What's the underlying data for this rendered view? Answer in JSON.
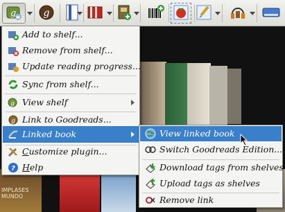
{
  "toolbar": {
    "buttons": [
      {
        "icon": "goodreads-sync-icon",
        "pressed": true
      },
      {
        "icon": "goodreads-g-icon"
      },
      {
        "icon": "bookmark-document-icon"
      },
      {
        "icon": "red-book-icon"
      },
      {
        "icon": "book-add-icon"
      },
      {
        "icon": "barcode-add-icon"
      },
      {
        "icon": "tomato-edit-icon"
      },
      {
        "icon": "paintbrush-edit-icon"
      },
      {
        "icon": "headphones-book-icon"
      },
      {
        "icon": "device-drive-icon"
      }
    ]
  },
  "main_menu": {
    "items": [
      {
        "label": "Add to shelf...",
        "icon": "add-to-shelf-icon"
      },
      {
        "label": "Remove from shelf...",
        "icon": "remove-from-shelf-icon"
      },
      {
        "label": "Update reading progress...",
        "icon": "update-progress-icon"
      },
      {
        "label": "Sync from shelf...",
        "icon": "sync-arrow-icon"
      },
      {
        "label": "View shelf",
        "icon": "view-shelf-icon",
        "has_submenu": true
      },
      {
        "label": "Link to Goodreads...",
        "icon": "link-goodreads-icon"
      },
      {
        "label": "Linked book",
        "icon": "linked-book-icon",
        "has_submenu": true,
        "active": true
      },
      {
        "label_prefix": "C",
        "label_rest": "ustomize plugin...",
        "icon": "tools-icon"
      },
      {
        "label_prefix": "H",
        "label_rest": "elp",
        "icon": "help-icon"
      }
    ]
  },
  "linked_book_submenu": {
    "items": [
      {
        "label": "View linked book",
        "icon": "globe-view-icon",
        "active": true
      },
      {
        "label": "Switch Goodreads Edition...",
        "icon": "switch-edition-icon"
      },
      {
        "label": "Download tags from shelves",
        "icon": "download-tags-icon"
      },
      {
        "label": "Upload tags as shelves",
        "icon": "upload-tags-icon"
      },
      {
        "label": "Remove link",
        "icon": "remove-link-icon"
      }
    ]
  },
  "background_covers": {
    "cover_text": "IMPLASES MUNDO"
  },
  "colors": {
    "menu_highlight": "#3a7fc9",
    "menu_background": "#f4f4f2",
    "toolbar_background": "#e8e8e3"
  }
}
